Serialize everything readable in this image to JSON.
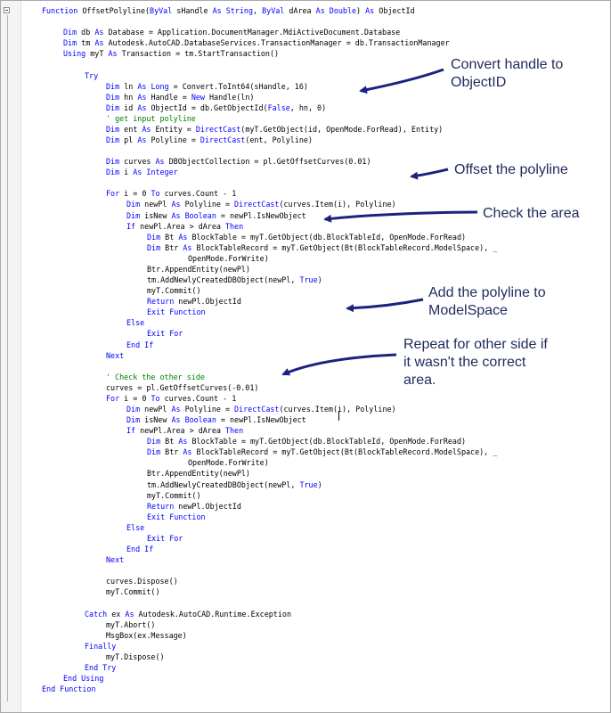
{
  "code_lines": [
    [
      {
        "t": "Function ",
        "k": 1
      },
      {
        "t": "OffsetPolyline("
      },
      {
        "t": "ByVal ",
        "k": 1
      },
      {
        "t": "sHandle "
      },
      {
        "t": "As String",
        "k": 1
      },
      {
        "t": ", "
      },
      {
        "t": "ByVal ",
        "k": 1
      },
      {
        "t": "dArea "
      },
      {
        "t": "As Double",
        "k": 1
      },
      {
        "t": ") "
      },
      {
        "t": "As ",
        "k": 1
      },
      {
        "t": "ObjectId"
      }
    ],
    [],
    [
      {
        "t": "Dim ",
        "k": 1
      },
      {
        "t": "db "
      },
      {
        "t": "As ",
        "k": 1
      },
      {
        "t": "Database = Application.DocumentManager.MdiActiveDocument.Database"
      }
    ],
    [
      {
        "t": "Dim ",
        "k": 1
      },
      {
        "t": "tm "
      },
      {
        "t": "As ",
        "k": 1
      },
      {
        "t": "Autodesk.AutoCAD.DatabaseServices.TransactionManager = db.TransactionManager"
      }
    ],
    [
      {
        "t": "Using ",
        "k": 1
      },
      {
        "t": "myT "
      },
      {
        "t": "As ",
        "k": 1
      },
      {
        "t": "Transaction = tm.StartTransaction()"
      }
    ],
    [],
    [
      {
        "t": "Try",
        "k": 1
      }
    ],
    [
      {
        "t": "Dim ",
        "k": 1
      },
      {
        "t": "ln "
      },
      {
        "t": "As Long",
        "k": 1
      },
      {
        "t": " = Convert.ToInt64(sHandle, 16)"
      }
    ],
    [
      {
        "t": "Dim ",
        "k": 1
      },
      {
        "t": "hn "
      },
      {
        "t": "As ",
        "k": 1
      },
      {
        "t": "Handle = "
      },
      {
        "t": "New ",
        "k": 1
      },
      {
        "t": "Handle(ln)"
      }
    ],
    [
      {
        "t": "Dim ",
        "k": 1
      },
      {
        "t": "id "
      },
      {
        "t": "As ",
        "k": 1
      },
      {
        "t": "ObjectId = db.GetObjectId("
      },
      {
        "t": "False",
        "k": 1
      },
      {
        "t": ", hn, 0)"
      }
    ],
    [
      {
        "t": "' get input polyline",
        "c": 1
      }
    ],
    [
      {
        "t": "Dim ",
        "k": 1
      },
      {
        "t": "ent "
      },
      {
        "t": "As ",
        "k": 1
      },
      {
        "t": "Entity = "
      },
      {
        "t": "DirectCast",
        "k": 1
      },
      {
        "t": "(myT.GetObject(id, OpenMode.ForRead), Entity)"
      }
    ],
    [
      {
        "t": "Dim ",
        "k": 1
      },
      {
        "t": "pl "
      },
      {
        "t": "As ",
        "k": 1
      },
      {
        "t": "Polyline = "
      },
      {
        "t": "DirectCast",
        "k": 1
      },
      {
        "t": "(ent, Polyline)"
      }
    ],
    [],
    [
      {
        "t": "Dim ",
        "k": 1
      },
      {
        "t": "curves "
      },
      {
        "t": "As ",
        "k": 1
      },
      {
        "t": "DBObjectCollection = pl.GetOffsetCurves(0.01)"
      }
    ],
    [
      {
        "t": "Dim ",
        "k": 1
      },
      {
        "t": "i "
      },
      {
        "t": "As Integer",
        "k": 1
      }
    ],
    [],
    [
      {
        "t": "For ",
        "k": 1
      },
      {
        "t": "i = 0 "
      },
      {
        "t": "To ",
        "k": 1
      },
      {
        "t": "curves.Count - 1"
      }
    ],
    [
      {
        "t": "Dim ",
        "k": 1
      },
      {
        "t": "newPl "
      },
      {
        "t": "As ",
        "k": 1
      },
      {
        "t": "Polyline = "
      },
      {
        "t": "DirectCast",
        "k": 1
      },
      {
        "t": "(curves.Item(i), Polyline)"
      }
    ],
    [
      {
        "t": "Dim ",
        "k": 1
      },
      {
        "t": "isNew "
      },
      {
        "t": "As Boolean",
        "k": 1
      },
      {
        "t": " = newPl.IsNewObject"
      }
    ],
    [
      {
        "t": "If ",
        "k": 1
      },
      {
        "t": "newPl.Area > dArea "
      },
      {
        "t": "Then",
        "k": 1
      }
    ],
    [
      {
        "t": "Dim ",
        "k": 1
      },
      {
        "t": "Bt "
      },
      {
        "t": "As ",
        "k": 1
      },
      {
        "t": "BlockTable = myT.GetObject(db.BlockTableId, OpenMode.ForRead)"
      }
    ],
    [
      {
        "t": "Dim ",
        "k": 1
      },
      {
        "t": "Btr "
      },
      {
        "t": "As ",
        "k": 1
      },
      {
        "t": "BlockTableRecord = myT.GetObject(Bt(BlockTableRecord.ModelSpace), _"
      }
    ],
    [
      {
        "t": "OpenMode.ForWrite)"
      }
    ],
    [
      {
        "t": "Btr.AppendEntity(newPl)"
      }
    ],
    [
      {
        "t": "tm.AddNewlyCreatedDBObject(newPl, "
      },
      {
        "t": "True",
        "k": 1
      },
      {
        "t": ")"
      }
    ],
    [
      {
        "t": "myT.Commit()"
      }
    ],
    [
      {
        "t": "Return ",
        "k": 1
      },
      {
        "t": "newPl.ObjectId"
      }
    ],
    [
      {
        "t": "Exit Function",
        "k": 1
      }
    ],
    [
      {
        "t": "Else",
        "k": 1
      }
    ],
    [
      {
        "t": "Exit For",
        "k": 1
      }
    ],
    [
      {
        "t": "End If",
        "k": 1
      }
    ],
    [
      {
        "t": "Next",
        "k": 1
      }
    ],
    [],
    [
      {
        "t": "' Check the other side",
        "c": 1
      }
    ],
    [
      {
        "t": "curves = pl.GetOffsetCurves(-0.01)"
      }
    ],
    [
      {
        "t": "For ",
        "k": 1
      },
      {
        "t": "i = 0 "
      },
      {
        "t": "To ",
        "k": 1
      },
      {
        "t": "curves.Count - 1"
      }
    ],
    [
      {
        "t": "Dim ",
        "k": 1
      },
      {
        "t": "newPl "
      },
      {
        "t": "As ",
        "k": 1
      },
      {
        "t": "Polyline = "
      },
      {
        "t": "DirectCast",
        "k": 1
      },
      {
        "t": "(curves.Item(i), Polyline)"
      }
    ],
    [
      {
        "t": "Dim ",
        "k": 1
      },
      {
        "t": "isNew "
      },
      {
        "t": "As Boolean",
        "k": 1
      },
      {
        "t": " = newPl.IsNewObject"
      }
    ],
    [
      {
        "t": "If ",
        "k": 1
      },
      {
        "t": "newPl.Area > dArea "
      },
      {
        "t": "Then",
        "k": 1
      }
    ],
    [
      {
        "t": "Dim ",
        "k": 1
      },
      {
        "t": "Bt "
      },
      {
        "t": "As ",
        "k": 1
      },
      {
        "t": "BlockTable = myT.GetObject(db.BlockTableId, OpenMode.ForRead)"
      }
    ],
    [
      {
        "t": "Dim ",
        "k": 1
      },
      {
        "t": "Btr "
      },
      {
        "t": "As ",
        "k": 1
      },
      {
        "t": "BlockTableRecord = myT.GetObject(Bt(BlockTableRecord.ModelSpace), _"
      }
    ],
    [
      {
        "t": "OpenMode.ForWrite)"
      }
    ],
    [
      {
        "t": "Btr.AppendEntity(newPl)"
      }
    ],
    [
      {
        "t": "tm.AddNewlyCreatedDBObject(newPl, "
      },
      {
        "t": "True",
        "k": 1
      },
      {
        "t": ")"
      }
    ],
    [
      {
        "t": "myT.Commit()"
      }
    ],
    [
      {
        "t": "Return ",
        "k": 1
      },
      {
        "t": "newPl.ObjectId"
      }
    ],
    [
      {
        "t": "Exit Function",
        "k": 1
      }
    ],
    [
      {
        "t": "Else",
        "k": 1
      }
    ],
    [
      {
        "t": "Exit For",
        "k": 1
      }
    ],
    [
      {
        "t": "End If",
        "k": 1
      }
    ],
    [
      {
        "t": "Next",
        "k": 1
      }
    ],
    [],
    [
      {
        "t": "curves.Dispose()"
      }
    ],
    [
      {
        "t": "myT.Commit()"
      }
    ],
    [],
    [
      {
        "t": "Catch ",
        "k": 1
      },
      {
        "t": "ex "
      },
      {
        "t": "As ",
        "k": 1
      },
      {
        "t": "Autodesk.AutoCAD.Runtime.Exception"
      }
    ],
    [
      {
        "t": "myT.Abort()"
      }
    ],
    [
      {
        "t": "MsgBox(ex.Message)"
      }
    ],
    [
      {
        "t": "Finally",
        "k": 1
      }
    ],
    [
      {
        "t": "myT.Dispose()"
      }
    ],
    [
      {
        "t": "End Try",
        "k": 1
      }
    ],
    [
      {
        "t": "End Using",
        "k": 1
      }
    ],
    [
      {
        "t": "End Function",
        "k": 1
      }
    ]
  ],
  "annotations": [
    {
      "text": "Convert handle to\nObjectID"
    },
    {
      "text": "Offset the polyline"
    },
    {
      "text": "Check the area"
    },
    {
      "text": "Add the polyline to\nModelSpace"
    },
    {
      "text": "Repeat for other side if\nit wasn't the correct\narea."
    }
  ],
  "colors": {
    "keyword": "#0000ff",
    "comment": "#008000",
    "callout": "#1f2a5a",
    "arrow": "#1a237e"
  }
}
